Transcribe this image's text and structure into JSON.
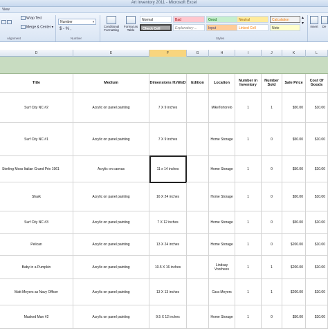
{
  "window": {
    "title": "Art Inventory 2011  -  Microsoft Excel"
  },
  "menu": [
    "View"
  ],
  "ribbon": {
    "wrap_text": "Wrap Text",
    "merge_center": "Merge & Center",
    "number_format": "Number",
    "currency_symbols": "$ - % ,",
    "conditional_formatting": "Conditional Formatting",
    "format_as_table": "Format as Table",
    "insert": "Insert",
    "delete": "De",
    "groups": {
      "alignment": "Alignment",
      "number": "Number",
      "styles": "Styles"
    },
    "styles": {
      "normal": "Normal",
      "bad": "Bad",
      "good": "Good",
      "neutral": "Neutral",
      "calculation": "Calculation",
      "check_cell": "Check Cell",
      "explanatory": "Explanatory ...",
      "input": "Input",
      "linked_cell": "Linked Cell",
      "note": "Note"
    }
  },
  "columns": [
    "D",
    "E",
    "F",
    "G",
    "H",
    "I",
    "J",
    "K",
    "L"
  ],
  "selected_column": "F",
  "table": {
    "headers": [
      "Title",
      "Medium",
      "Dimensions HxWxD",
      "Edition",
      "Location",
      "Number in Inventory",
      "Number Sold",
      "Sale Price",
      "Cost Of Goods"
    ],
    "rows": [
      [
        "Surf City NC #2",
        "Acrylic on panel painting",
        "7 X 9 inches",
        "",
        "MikeTortorelo",
        "1",
        "1",
        "$50.00",
        "$10.00"
      ],
      [
        "Surf City NC #1",
        "Acrylic on panel painting",
        "7 X 9 inches",
        "",
        "Home Storage",
        "1",
        "0",
        "$50.00",
        "$10.00"
      ],
      [
        "Sterling Moss  Italian Grand Prix 1961",
        "Acrylic on canvas",
        "11 x 14 inches",
        "",
        "Home Storage",
        "1",
        "0",
        "$50.00",
        "$10.00"
      ],
      [
        "Shark",
        "Acrylic on panel painting",
        "16 X 24 inches",
        "",
        "Home Storage",
        "1",
        "0",
        "$50.00",
        "$10.00"
      ],
      [
        "Surf City NC #3",
        "Acrylic on panel painting",
        "7 X 12 inches",
        "",
        "Home Storage",
        "1",
        "0",
        "$50.00",
        "$10.00"
      ],
      [
        "Pelican",
        "Acrylic on panel painting",
        "13 X 24 inches",
        "",
        "Home Storage",
        "1",
        "0",
        "$200.00",
        "$10.00"
      ],
      [
        "Baby in a Pumpkin",
        "Acrylic on panel painting",
        "10.5 X 16 inches",
        "",
        "Lindsay Voorhees",
        "1",
        "1",
        "$200.00",
        "$10.00"
      ],
      [
        "Matt Meyers as Navy Officer",
        "Acrylic on panel painting",
        "13 X 13 inches",
        "",
        "Cara Meyers",
        "1",
        "1",
        "$200.00",
        "$10.00"
      ],
      [
        "Masked Man #2",
        "Acrylic on panel painting",
        "9.5 X 12 inches",
        "",
        "Home Storage",
        "1",
        "0",
        "$50.00",
        "$10.00"
      ]
    ]
  }
}
